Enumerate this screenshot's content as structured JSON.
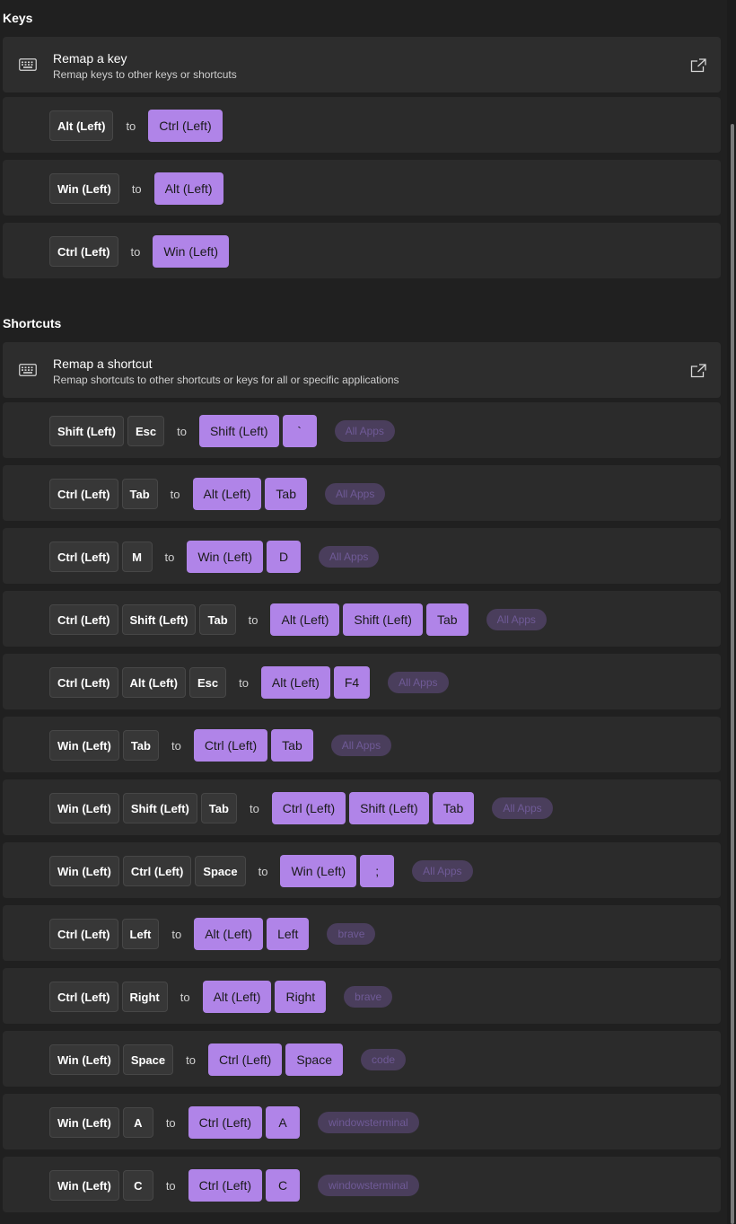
{
  "keys_section": {
    "title": "Keys",
    "header": {
      "title": "Remap a key",
      "description": "Remap keys to other keys or shortcuts",
      "icon": "keyboard-icon",
      "action_icon": "open-external-icon"
    },
    "remaps": [
      {
        "from": [
          "Alt (Left)"
        ],
        "to": [
          "Ctrl (Left)"
        ]
      },
      {
        "from": [
          "Win (Left)"
        ],
        "to": [
          "Alt (Left)"
        ]
      },
      {
        "from": [
          "Ctrl (Left)"
        ],
        "to": [
          "Win (Left)"
        ]
      }
    ]
  },
  "shortcuts_section": {
    "title": "Shortcuts",
    "header": {
      "title": "Remap a shortcut",
      "description": "Remap shortcuts to other shortcuts or keys for all or specific applications",
      "icon": "keyboard-icon",
      "action_icon": "open-external-icon"
    },
    "remaps": [
      {
        "from": [
          "Shift (Left)",
          "Esc"
        ],
        "to": [
          "Shift (Left)",
          "`"
        ],
        "app": "All Apps"
      },
      {
        "from": [
          "Ctrl (Left)",
          "Tab"
        ],
        "to": [
          "Alt (Left)",
          "Tab"
        ],
        "app": "All Apps"
      },
      {
        "from": [
          "Ctrl (Left)",
          "M"
        ],
        "to": [
          "Win (Left)",
          "D"
        ],
        "app": "All Apps"
      },
      {
        "from": [
          "Ctrl (Left)",
          "Shift (Left)",
          "Tab"
        ],
        "to": [
          "Alt (Left)",
          "Shift (Left)",
          "Tab"
        ],
        "app": "All Apps"
      },
      {
        "from": [
          "Ctrl (Left)",
          "Alt (Left)",
          "Esc"
        ],
        "to": [
          "Alt (Left)",
          "F4"
        ],
        "app": "All Apps"
      },
      {
        "from": [
          "Win (Left)",
          "Tab"
        ],
        "to": [
          "Ctrl (Left)",
          "Tab"
        ],
        "app": "All Apps"
      },
      {
        "from": [
          "Win (Left)",
          "Shift (Left)",
          "Tab"
        ],
        "to": [
          "Ctrl (Left)",
          "Shift (Left)",
          "Tab"
        ],
        "app": "All Apps"
      },
      {
        "from": [
          "Win (Left)",
          "Ctrl (Left)",
          "Space"
        ],
        "to": [
          "Win (Left)",
          ";"
        ],
        "app": "All Apps"
      },
      {
        "from": [
          "Ctrl (Left)",
          "Left"
        ],
        "to": [
          "Alt (Left)",
          "Left"
        ],
        "app": "brave"
      },
      {
        "from": [
          "Ctrl (Left)",
          "Right"
        ],
        "to": [
          "Alt (Left)",
          "Right"
        ],
        "app": "brave"
      },
      {
        "from": [
          "Win (Left)",
          "Space"
        ],
        "to": [
          "Ctrl (Left)",
          "Space"
        ],
        "app": "code"
      },
      {
        "from": [
          "Win (Left)",
          "A"
        ],
        "to": [
          "Ctrl (Left)",
          "A"
        ],
        "app": "windowsterminal"
      },
      {
        "from": [
          "Win (Left)",
          "C"
        ],
        "to": [
          "Ctrl (Left)",
          "C"
        ],
        "app": "windowsterminal"
      }
    ]
  },
  "separator_label": "to",
  "colors": {
    "background": "#202020",
    "card": "#2b2b2b",
    "source_key": "#373737",
    "target_key": "#b084e8",
    "app_tag": "#4a3e5c"
  }
}
